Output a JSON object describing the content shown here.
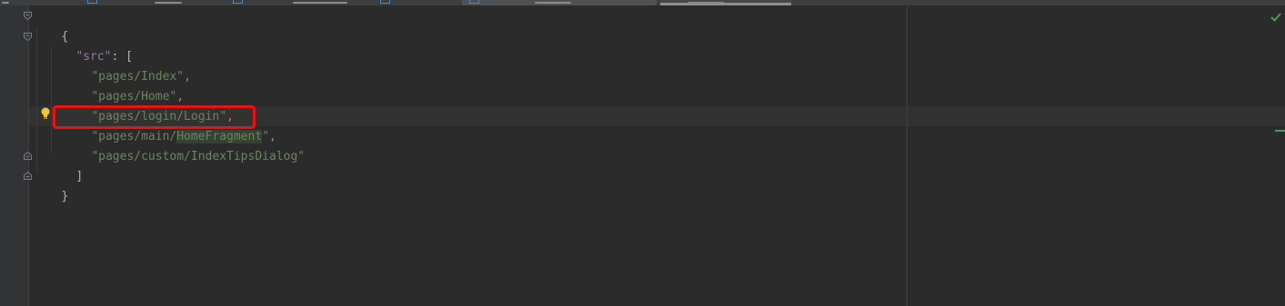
{
  "tabs": [
    {
      "label": "",
      "active": false
    },
    {
      "label": "",
      "active": false
    },
    {
      "label": "",
      "active": false
    },
    {
      "label": "",
      "active": false
    },
    {
      "label": "",
      "active": true
    },
    {
      "label": "",
      "selected": true
    }
  ],
  "code": {
    "open_brace": "{",
    "key": "\"src\"",
    "colon": ": ",
    "open_bracket": "[",
    "items": [
      {
        "value": "\"pages/Index\"",
        "comma": ","
      },
      {
        "value": "\"pages/Home\"",
        "comma": ","
      },
      {
        "value": "\"pages/login/Login\"",
        "comma": ","
      },
      {
        "value_prefix": "\"pages/main/",
        "value_match": "HomeFragment",
        "value_suffix": "\"",
        "comma": ","
      },
      {
        "value": "\"pages/custom/IndexTipsDialog\"",
        "comma": ""
      }
    ],
    "close_bracket": "]",
    "close_brace": "}"
  },
  "status": {
    "inspection_icon": "check-icon",
    "intention_icon": "lightbulb-icon"
  },
  "colors": {
    "background": "#2b2b2b",
    "string": "#6a8759",
    "key": "#9876aa",
    "punctuation": "#cc7832",
    "highlight_border": "#ee1111",
    "check": "#499c54"
  }
}
